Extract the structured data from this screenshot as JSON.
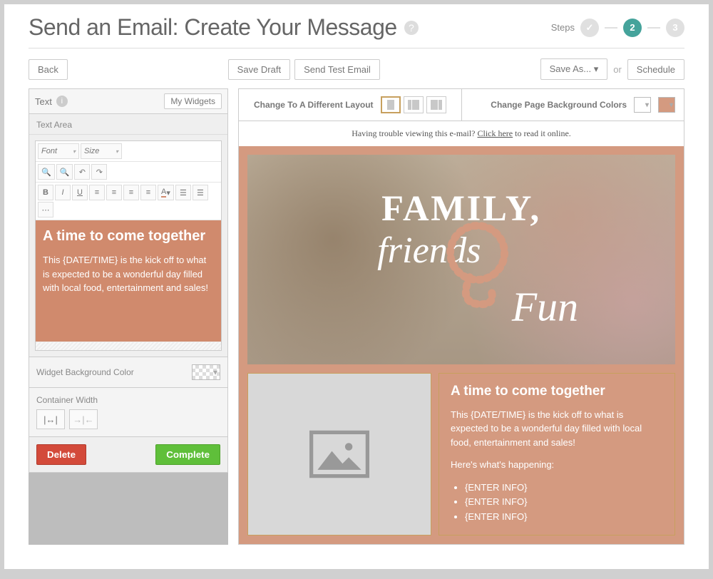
{
  "header": {
    "title": "Send an Email: Create Your Message",
    "steps_label": "Steps",
    "step1_check": "✓",
    "step2": "2",
    "step3": "3"
  },
  "actionbar": {
    "back": "Back",
    "save_draft": "Save Draft",
    "send_test": "Send Test Email",
    "save_as": "Save As... ▾",
    "or": "or",
    "schedule": "Schedule"
  },
  "sidebar": {
    "panel_title": "Text",
    "my_widgets": "My Widgets",
    "text_area_label": "Text Area",
    "font_label": "Font",
    "size_label": "Size",
    "editor": {
      "heading": "A time to come together",
      "body": "This {DATE/TIME} is the kick off to what is expected to be a wonderful day filled with local food, entertainment and sales!"
    },
    "widget_bg_label": "Widget Background Color",
    "container_width_label": "Container Width",
    "delete": "Delete",
    "complete": "Complete"
  },
  "canvas": {
    "change_layout": "Change To A Different Layout",
    "change_bg": "Change Page Background Colors",
    "trouble_prefix": "Having trouble viewing this e-mail? ",
    "trouble_link": "Click here",
    "trouble_suffix": " to read it online.",
    "hero": {
      "line1": "FAMILY,",
      "line2": "friends",
      "line3": "Fun"
    },
    "block": {
      "heading": "A time to come together",
      "p1": "This {DATE/TIME} is the kick off to what is expected to be a wonderful day filled with local food, entertainment and sales!",
      "p2": "Here's what's happening:",
      "items": [
        "{ENTER INFO}",
        "{ENTER INFO}",
        "{ENTER INFO}"
      ]
    }
  },
  "colors": {
    "accent": "#45a39b",
    "brand_copper": "#d49a80",
    "danger": "#d34a3a",
    "success": "#5fbf3a"
  }
}
